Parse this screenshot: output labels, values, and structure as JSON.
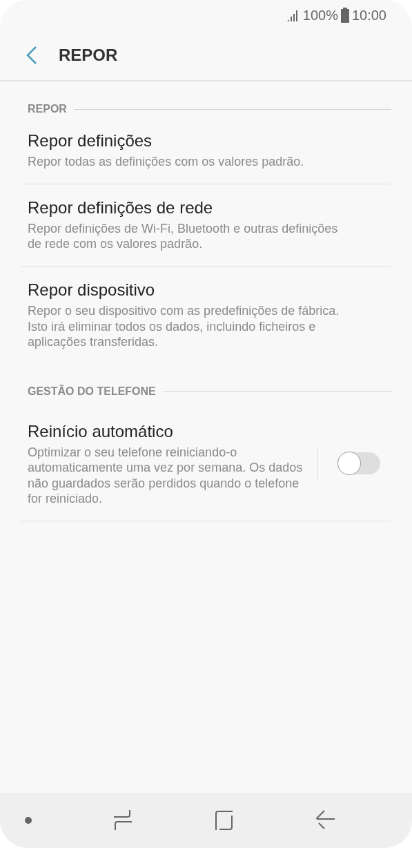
{
  "status_bar": {
    "battery": "100%",
    "time": "10:00"
  },
  "header": {
    "title": "REPOR"
  },
  "sections": [
    {
      "title": "REPOR",
      "items": [
        {
          "title": "Repor definições",
          "description": "Repor todas as definições com os valores padrão."
        },
        {
          "title": "Repor definições de rede",
          "description": "Repor definições de Wi-Fi, Bluetooth e outras definições de rede com os valores padrão."
        },
        {
          "title": "Repor dispositivo",
          "description": "Repor o seu dispositivo com as predefinições de fábrica. Isto irá eliminar todos os dados, incluindo ficheiros e aplicações transferidas."
        }
      ]
    },
    {
      "title": "GESTÃO DO TELEFONE",
      "items": [
        {
          "title": "Reinício automático",
          "description": "Optimizar o seu telefone reiniciando-o automaticamente uma vez por semana. Os dados não guardados serão perdidos quando o telefone for reiniciado.",
          "kind": "switch",
          "on": false
        }
      ]
    }
  ]
}
